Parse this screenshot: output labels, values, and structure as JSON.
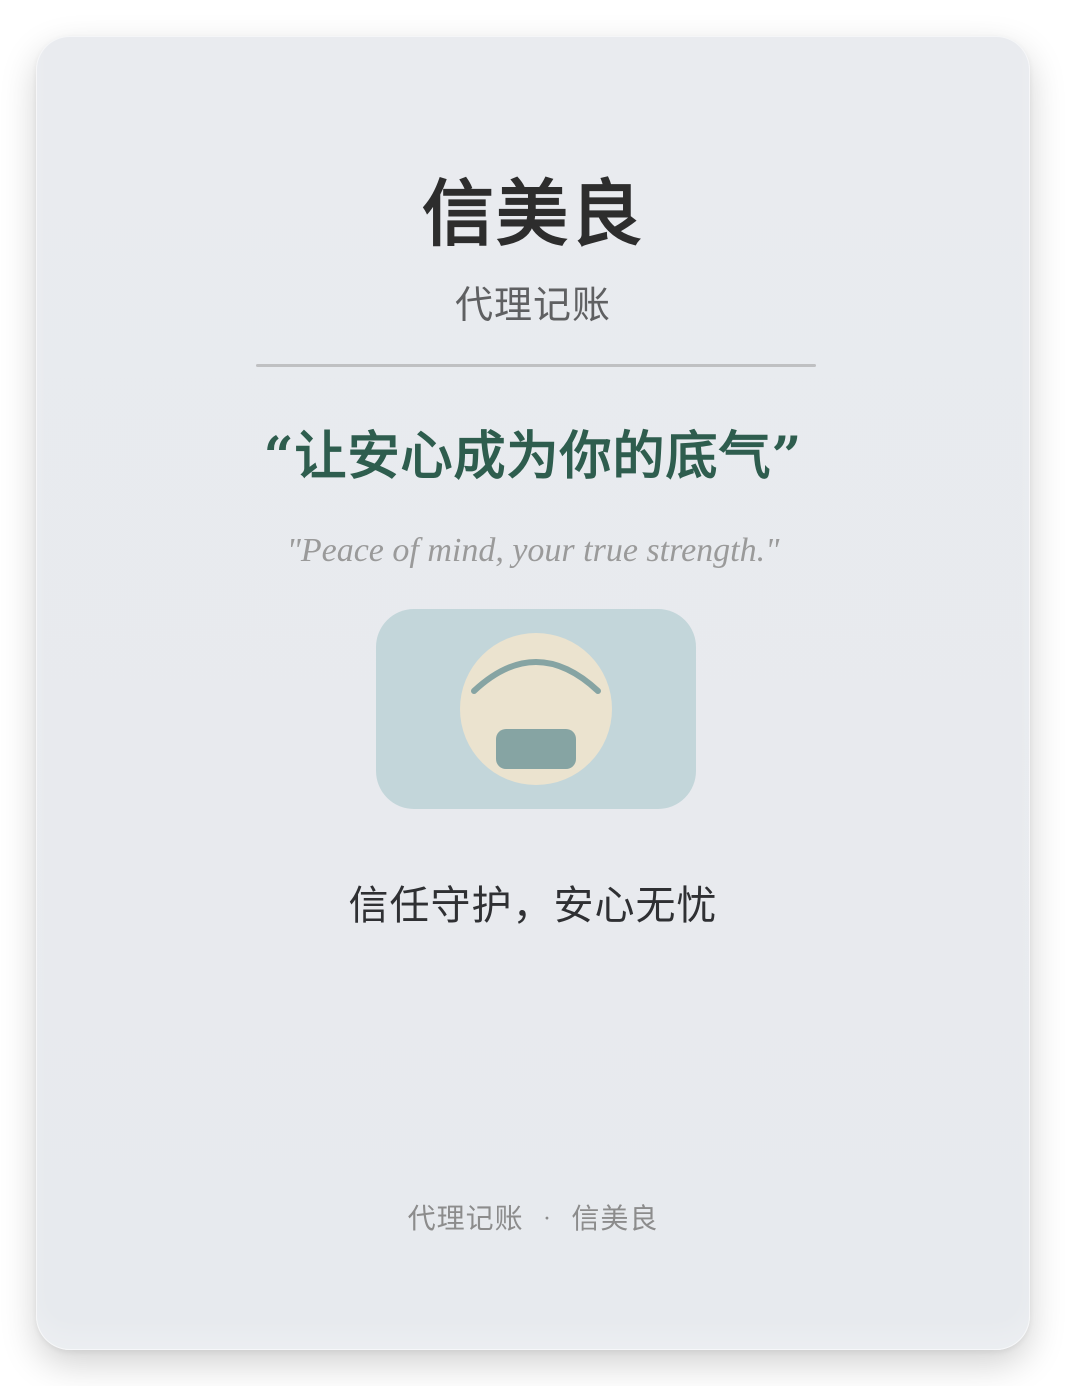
{
  "brand": {
    "name": "信美良",
    "service": "代理记账"
  },
  "slogan": {
    "cn": "“让安心成为你的底气”",
    "en": "\"Peace of mind, your true strength.\""
  },
  "caption": "信任守护，安心无忧",
  "footer": {
    "left": "代理记账",
    "separator": "·",
    "right": "信美良"
  },
  "icon": {
    "name": "trust-badge-icon"
  },
  "colors": {
    "accent": "#2e5d4e",
    "title": "#2d2d2d",
    "subtitle": "#5f6062",
    "divider": "#bfc0c2",
    "icon_bg": "#c3d6da",
    "icon_face": "#ebe3cf",
    "icon_mark": "#86a4a3",
    "footer": "#8c8c8c"
  }
}
